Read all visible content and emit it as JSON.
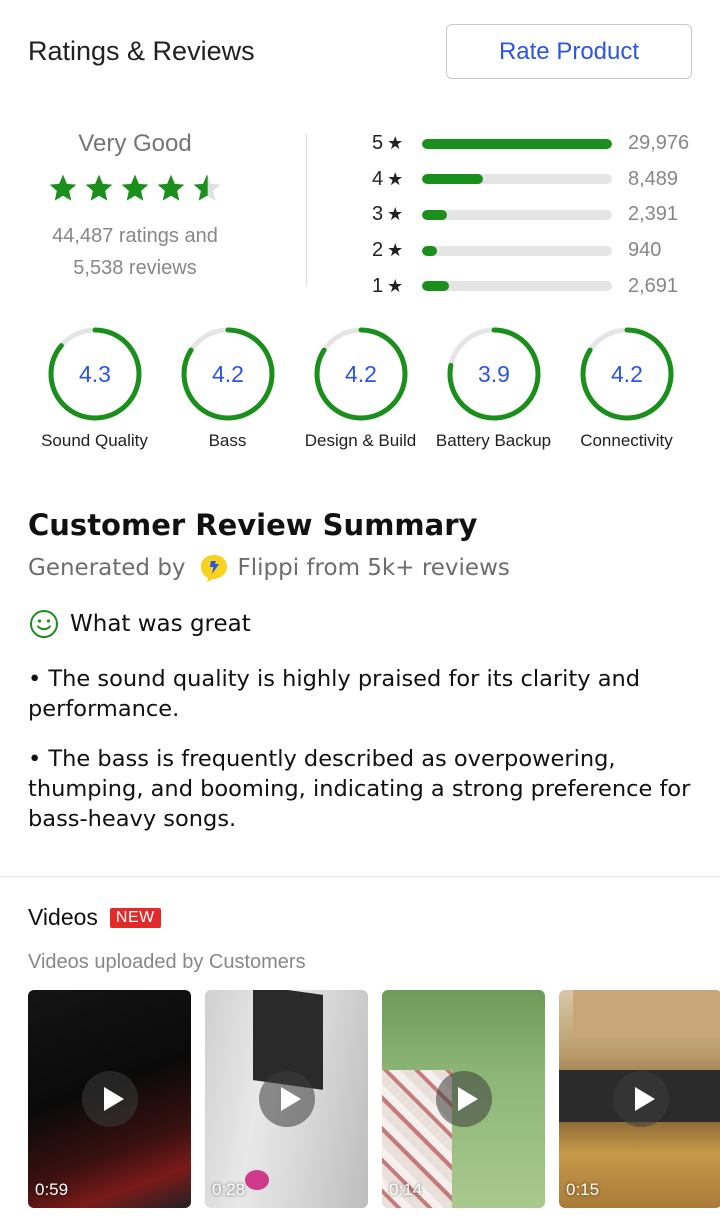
{
  "header": {
    "title": "Ratings & Reviews",
    "rate_button": "Rate Product"
  },
  "summary": {
    "label": "Very Good",
    "rating_value": 4.5,
    "ratings_text": "44,487 ratings and",
    "reviews_text": "5,538 reviews"
  },
  "distribution": [
    {
      "star": "5",
      "count": "29,976",
      "fraction": 1.0
    },
    {
      "star": "4",
      "count": "8,489",
      "fraction": 0.32
    },
    {
      "star": "3",
      "count": "2,391",
      "fraction": 0.13
    },
    {
      "star": "2",
      "count": "940",
      "fraction": 0.08
    },
    {
      "star": "1",
      "count": "2,691",
      "fraction": 0.14
    }
  ],
  "star_symbol": "★",
  "aspects": [
    {
      "value": "4.3",
      "name": "Sound Quality",
      "fraction": 0.86
    },
    {
      "value": "4.2",
      "name": "Bass",
      "fraction": 0.84
    },
    {
      "value": "4.2",
      "name": "Design & Build",
      "fraction": 0.84
    },
    {
      "value": "3.9",
      "name": "Battery Backup",
      "fraction": 0.78
    },
    {
      "value": "4.2",
      "name": "Connectivity",
      "fraction": 0.84
    }
  ],
  "review_summary": {
    "title": "Customer Review Summary",
    "generated_by": "Generated by",
    "source": "Flippi from 5k+ reviews",
    "great_heading": "What was great",
    "points": [
      "• The sound quality is highly praised for its clarity and performance.",
      "• The bass is frequently described as overpowering, thumping, and booming, indicating a strong preference for bass-heavy songs."
    ]
  },
  "videos": {
    "title": "Videos",
    "badge": "NEW",
    "subtitle": "Videos uploaded by Customers",
    "items": [
      {
        "duration": "0:59"
      },
      {
        "duration": "0:28"
      },
      {
        "duration": "0:14"
      },
      {
        "duration": "0:15"
      }
    ]
  },
  "colors": {
    "green": "#1b8f1b",
    "blue": "#2a55e5",
    "track": "#e5e5e5",
    "badge": "#e12b2b"
  }
}
